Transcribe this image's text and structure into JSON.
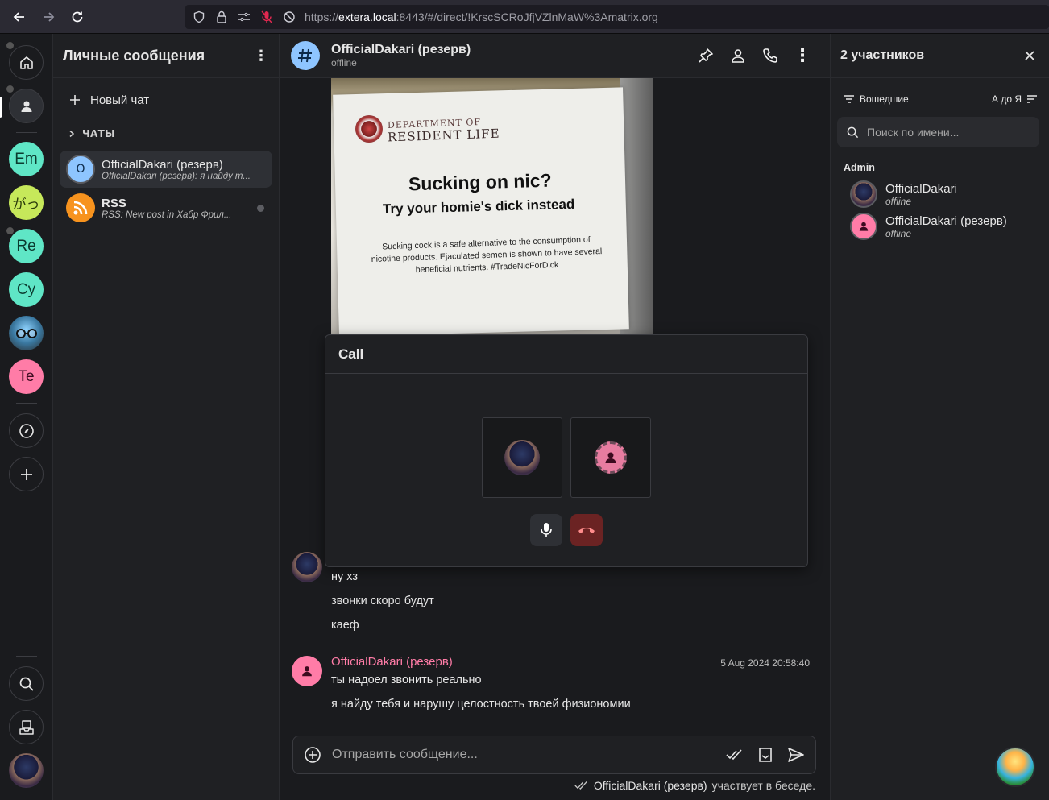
{
  "browser": {
    "url_prefix": "https://",
    "url_host": "extera.local",
    "url_rest": ":8443/#/direct/!KrscSCRoJfjVZlnMaW%3Amatrix.org"
  },
  "rail": {
    "items": [
      {
        "label": "Em",
        "color": "#5fe6c6"
      },
      {
        "label": "がっ",
        "color": "#c6e85a"
      },
      {
        "label": "Re",
        "color": "#5fe6c6"
      },
      {
        "label": "Cy",
        "color": "#5fe6c6"
      },
      {
        "label": "Te",
        "color": "#ff7ca7"
      }
    ]
  },
  "sidebar": {
    "title": "Личные сообщения",
    "new_chat": "Новый чат",
    "section": "ЧАТЫ",
    "rooms": [
      {
        "avatar": "O",
        "name": "OfficialDakari (резерв)",
        "preview": "OfficialDakari (резерв): я найду т..."
      },
      {
        "avatar": "rss-icon",
        "name": "RSS",
        "preview": "RSS: New post in Хабр Фрил..."
      }
    ]
  },
  "room": {
    "name": "OfficialDakari (резерв)",
    "status": "offline"
  },
  "poster": {
    "dept": "DEPARTMENT OF",
    "res": "RESIDENT LIFE",
    "h1": "Sucking on nic?",
    "h2": "Try your homie's dick instead",
    "body": "Sucking cock is a safe alternative to the consumption of nicotine products. Ejaculated semen is shown to have several beneficial nutrients. #TradeNicForDick"
  },
  "call": {
    "title": "Call"
  },
  "messages": {
    "group1": [
      "ну хз",
      "звонки скоро будут",
      "каеф"
    ],
    "group2": {
      "sender": "OfficialDakari (резерв)",
      "time": "5 Aug 2024 20:58:40",
      "lines": [
        "ты надоел звонить реально",
        "я найду тебя и нарушу целостность твоей физиономии"
      ]
    }
  },
  "composer": {
    "placeholder": "Отправить сообщение..."
  },
  "typing": {
    "name": "OfficialDakari (резерв)",
    "text": "участвует в беседе."
  },
  "members": {
    "title": "2 участников",
    "filter": "Вошедшие",
    "sort": "А до Я",
    "search_placeholder": "Поиск по имени...",
    "role": "Admin",
    "list": [
      {
        "name": "OfficialDakari",
        "status": "offline"
      },
      {
        "name": "OfficialDakari (резерв)",
        "status": "offline"
      }
    ]
  },
  "colors": {
    "accent_pink": "#ff7ca7",
    "hangup": "#6b2323",
    "room_avatar": "#8ec5ff"
  }
}
